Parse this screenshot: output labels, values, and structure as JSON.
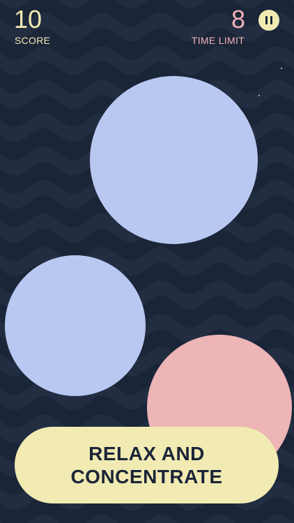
{
  "hud": {
    "score_value": "10",
    "score_label": "SCORE",
    "time_value": "8",
    "time_label": "TIME LIMIT",
    "pause_icon": "pause-icon"
  },
  "circles": [
    {
      "color": "#b8c8f1"
    },
    {
      "color": "#b8c8f1"
    },
    {
      "color": "#edb5b6"
    }
  ],
  "message": {
    "text": "RELAX AND\nCONCENTRATE"
  },
  "colors": {
    "background": "#1b2538",
    "wave": "#222d42",
    "accent_yellow": "#f1ebb3",
    "accent_pink": "#f0b3b7",
    "circle_blue": "#b8c8f1",
    "circle_pink": "#edb5b6"
  }
}
